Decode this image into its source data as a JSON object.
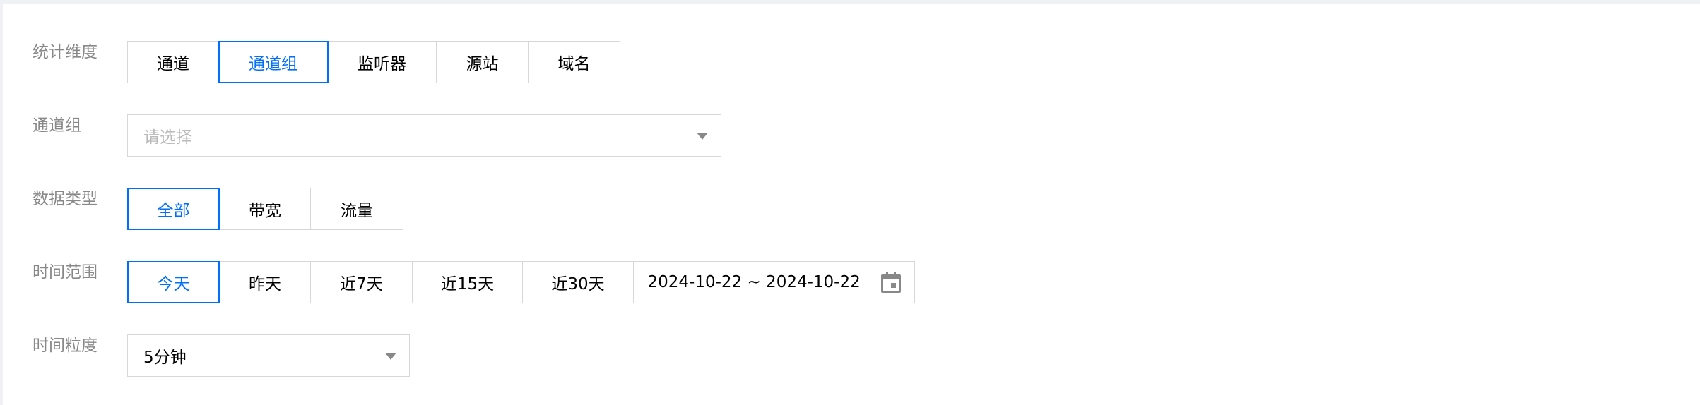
{
  "dimension": {
    "label": "统计维度",
    "options": [
      "通道",
      "通道组",
      "监听器",
      "源站",
      "域名"
    ],
    "selected": "通道组"
  },
  "channel_group": {
    "label": "通道组",
    "placeholder": "请选择"
  },
  "data_type": {
    "label": "数据类型",
    "options": [
      "全部",
      "带宽",
      "流量"
    ],
    "selected": "全部"
  },
  "time_range": {
    "label": "时间范围",
    "options": [
      "今天",
      "昨天",
      "近7天",
      "近15天",
      "近30天"
    ],
    "selected": "今天",
    "date_range": "2024-10-22 ~ 2024-10-22"
  },
  "granularity": {
    "label": "时间粒度",
    "value": "5分钟"
  },
  "colors": {
    "accent": "#006eff",
    "border": "#d7d7d7",
    "label": "#888888",
    "placeholder": "#b9b9b9"
  }
}
